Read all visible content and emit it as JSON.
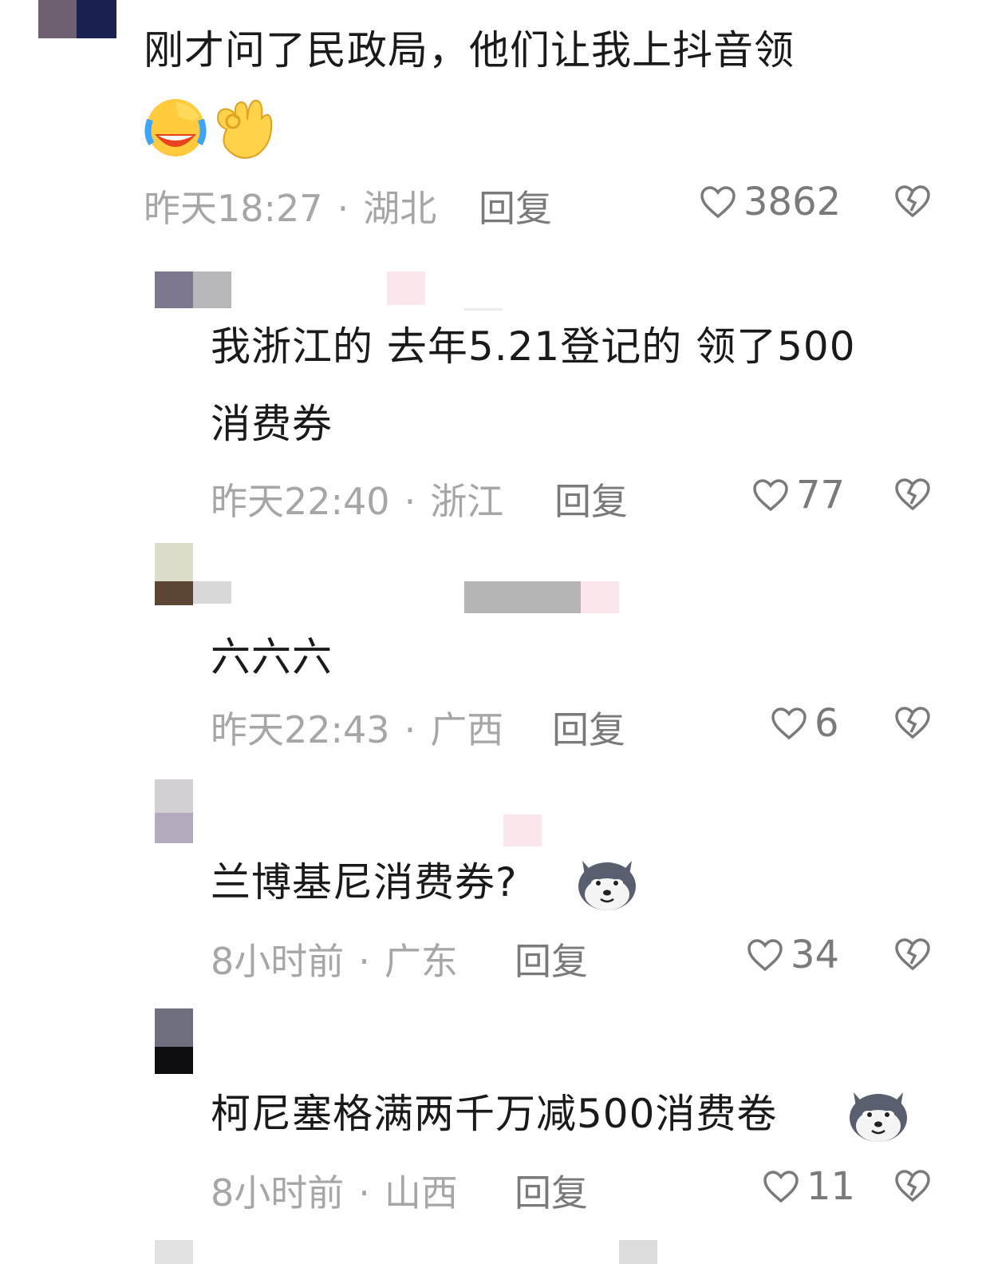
{
  "comments": [
    {
      "text_line1": "刚才问了民政局，他们让我上抖音领",
      "emojis": [
        "crying-laughing-emoji",
        "ok-hand-emoji"
      ],
      "time": "昨天18:27",
      "location": "湖北",
      "reply": "回复",
      "likes": "3862"
    },
    {
      "text_line1": "我浙江的 去年5.21登记的 领了500",
      "text_line2": "消费券",
      "time": "昨天22:40",
      "location": "浙江",
      "reply": "回复",
      "likes": "77"
    },
    {
      "text_line1": "六六六",
      "time": "昨天22:43",
      "location": "广西",
      "reply": "回复",
      "likes": "6"
    },
    {
      "text_line1": "兰博基尼消费券?",
      "emojis": [
        "husky-dog-emoji"
      ],
      "time": "8小时前",
      "location": "广东",
      "reply": "回复",
      "likes": "34"
    },
    {
      "text_line1": "柯尼塞格满两千万减500消费卷",
      "emojis": [
        "husky-dog-emoji"
      ],
      "time": "8小时前",
      "location": "山西",
      "reply": "回复",
      "likes": "11"
    }
  ],
  "separator": "·",
  "colors": {
    "meta": "#a6a6a6",
    "action": "#7a7a7a",
    "text": "#1a1a1a"
  }
}
